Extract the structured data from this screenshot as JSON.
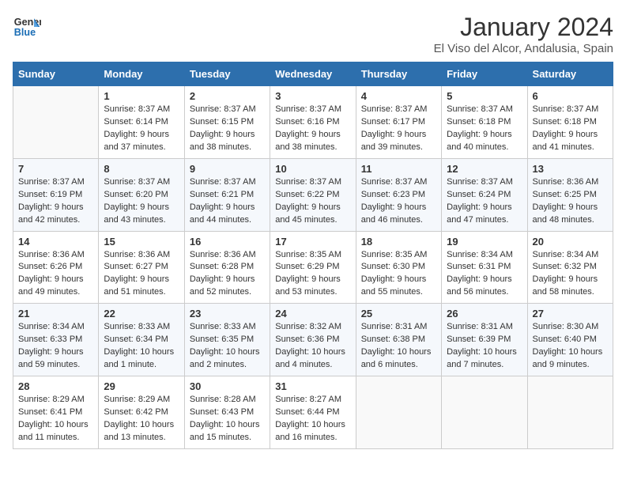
{
  "header": {
    "logo_line1": "General",
    "logo_line2": "Blue",
    "main_title": "January 2024",
    "subtitle": "El Viso del Alcor, Andalusia, Spain"
  },
  "calendar": {
    "days_of_week": [
      "Sunday",
      "Monday",
      "Tuesday",
      "Wednesday",
      "Thursday",
      "Friday",
      "Saturday"
    ],
    "weeks": [
      [
        {
          "day": "",
          "info": ""
        },
        {
          "day": "1",
          "info": "Sunrise: 8:37 AM\nSunset: 6:14 PM\nDaylight: 9 hours\nand 37 minutes."
        },
        {
          "day": "2",
          "info": "Sunrise: 8:37 AM\nSunset: 6:15 PM\nDaylight: 9 hours\nand 38 minutes."
        },
        {
          "day": "3",
          "info": "Sunrise: 8:37 AM\nSunset: 6:16 PM\nDaylight: 9 hours\nand 38 minutes."
        },
        {
          "day": "4",
          "info": "Sunrise: 8:37 AM\nSunset: 6:17 PM\nDaylight: 9 hours\nand 39 minutes."
        },
        {
          "day": "5",
          "info": "Sunrise: 8:37 AM\nSunset: 6:18 PM\nDaylight: 9 hours\nand 40 minutes."
        },
        {
          "day": "6",
          "info": "Sunrise: 8:37 AM\nSunset: 6:18 PM\nDaylight: 9 hours\nand 41 minutes."
        }
      ],
      [
        {
          "day": "7",
          "info": "Sunrise: 8:37 AM\nSunset: 6:19 PM\nDaylight: 9 hours\nand 42 minutes."
        },
        {
          "day": "8",
          "info": "Sunrise: 8:37 AM\nSunset: 6:20 PM\nDaylight: 9 hours\nand 43 minutes."
        },
        {
          "day": "9",
          "info": "Sunrise: 8:37 AM\nSunset: 6:21 PM\nDaylight: 9 hours\nand 44 minutes."
        },
        {
          "day": "10",
          "info": "Sunrise: 8:37 AM\nSunset: 6:22 PM\nDaylight: 9 hours\nand 45 minutes."
        },
        {
          "day": "11",
          "info": "Sunrise: 8:37 AM\nSunset: 6:23 PM\nDaylight: 9 hours\nand 46 minutes."
        },
        {
          "day": "12",
          "info": "Sunrise: 8:37 AM\nSunset: 6:24 PM\nDaylight: 9 hours\nand 47 minutes."
        },
        {
          "day": "13",
          "info": "Sunrise: 8:36 AM\nSunset: 6:25 PM\nDaylight: 9 hours\nand 48 minutes."
        }
      ],
      [
        {
          "day": "14",
          "info": "Sunrise: 8:36 AM\nSunset: 6:26 PM\nDaylight: 9 hours\nand 49 minutes."
        },
        {
          "day": "15",
          "info": "Sunrise: 8:36 AM\nSunset: 6:27 PM\nDaylight: 9 hours\nand 51 minutes."
        },
        {
          "day": "16",
          "info": "Sunrise: 8:36 AM\nSunset: 6:28 PM\nDaylight: 9 hours\nand 52 minutes."
        },
        {
          "day": "17",
          "info": "Sunrise: 8:35 AM\nSunset: 6:29 PM\nDaylight: 9 hours\nand 53 minutes."
        },
        {
          "day": "18",
          "info": "Sunrise: 8:35 AM\nSunset: 6:30 PM\nDaylight: 9 hours\nand 55 minutes."
        },
        {
          "day": "19",
          "info": "Sunrise: 8:34 AM\nSunset: 6:31 PM\nDaylight: 9 hours\nand 56 minutes."
        },
        {
          "day": "20",
          "info": "Sunrise: 8:34 AM\nSunset: 6:32 PM\nDaylight: 9 hours\nand 58 minutes."
        }
      ],
      [
        {
          "day": "21",
          "info": "Sunrise: 8:34 AM\nSunset: 6:33 PM\nDaylight: 9 hours\nand 59 minutes."
        },
        {
          "day": "22",
          "info": "Sunrise: 8:33 AM\nSunset: 6:34 PM\nDaylight: 10 hours\nand 1 minute."
        },
        {
          "day": "23",
          "info": "Sunrise: 8:33 AM\nSunset: 6:35 PM\nDaylight: 10 hours\nand 2 minutes."
        },
        {
          "day": "24",
          "info": "Sunrise: 8:32 AM\nSunset: 6:36 PM\nDaylight: 10 hours\nand 4 minutes."
        },
        {
          "day": "25",
          "info": "Sunrise: 8:31 AM\nSunset: 6:38 PM\nDaylight: 10 hours\nand 6 minutes."
        },
        {
          "day": "26",
          "info": "Sunrise: 8:31 AM\nSunset: 6:39 PM\nDaylight: 10 hours\nand 7 minutes."
        },
        {
          "day": "27",
          "info": "Sunrise: 8:30 AM\nSunset: 6:40 PM\nDaylight: 10 hours\nand 9 minutes."
        }
      ],
      [
        {
          "day": "28",
          "info": "Sunrise: 8:29 AM\nSunset: 6:41 PM\nDaylight: 10 hours\nand 11 minutes."
        },
        {
          "day": "29",
          "info": "Sunrise: 8:29 AM\nSunset: 6:42 PM\nDaylight: 10 hours\nand 13 minutes."
        },
        {
          "day": "30",
          "info": "Sunrise: 8:28 AM\nSunset: 6:43 PM\nDaylight: 10 hours\nand 15 minutes."
        },
        {
          "day": "31",
          "info": "Sunrise: 8:27 AM\nSunset: 6:44 PM\nDaylight: 10 hours\nand 16 minutes."
        },
        {
          "day": "",
          "info": ""
        },
        {
          "day": "",
          "info": ""
        },
        {
          "day": "",
          "info": ""
        }
      ]
    ]
  }
}
